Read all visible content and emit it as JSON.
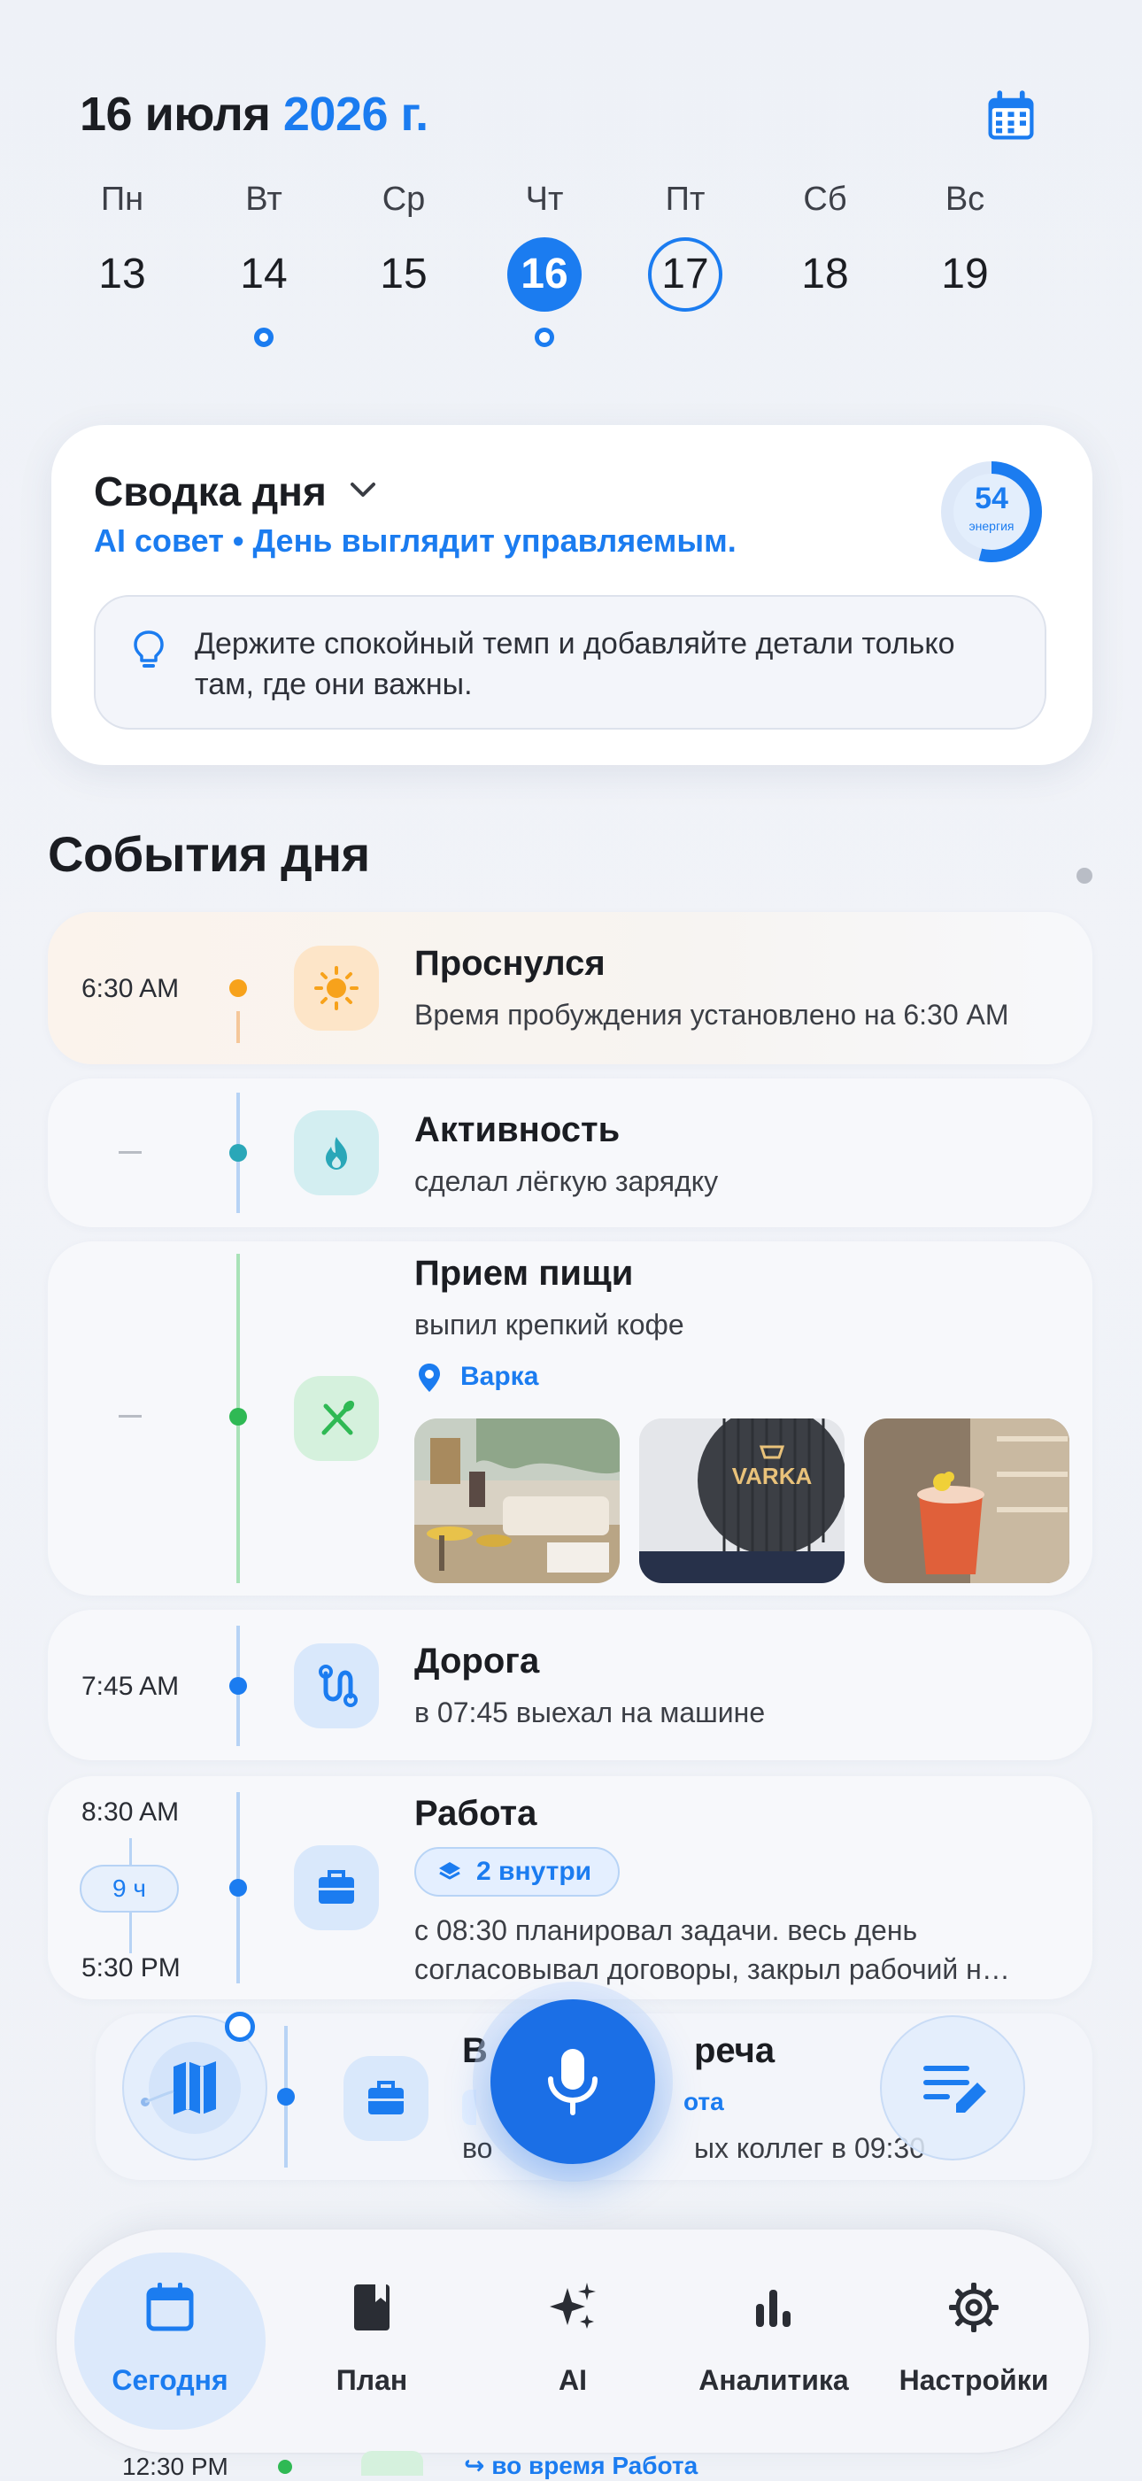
{
  "header": {
    "date_prefix": "16 июля",
    "year": "2026 г."
  },
  "week": [
    {
      "name": "Пн",
      "num": "13"
    },
    {
      "name": "Вт",
      "num": "14"
    },
    {
      "name": "Ср",
      "num": "15"
    },
    {
      "name": "Чт",
      "num": "16"
    },
    {
      "name": "Пт",
      "num": "17"
    },
    {
      "name": "Сб",
      "num": "18"
    },
    {
      "name": "Вс",
      "num": "19"
    }
  ],
  "summary": {
    "title": "Сводка дня",
    "ai_tip": "AI совет • День выглядит управляемым.",
    "energy_value": "54",
    "energy_label": "энергия",
    "energy_fraction": 0.54,
    "tip": "Держите спокойный темп и добавляйте детали только там, где они важны."
  },
  "events_title": "События дня",
  "events": {
    "wake": {
      "time": "6:30 AM",
      "title": "Проснулся",
      "desc": "Время пробуждения установлено на 6:30 AM"
    },
    "activity": {
      "title": "Активность",
      "desc": "сделал лёгкую зарядку"
    },
    "meal": {
      "title": "Прием пищи",
      "desc": "выпил крепкий кофе",
      "place": "Варка"
    },
    "road": {
      "time": "7:45 AM",
      "title": "Дорога",
      "desc": "в 07:45 выехал на машине"
    },
    "work": {
      "time_start": "8:30 AM",
      "duration": "9 ч",
      "time_end": "5:30 PM",
      "title": "Работа",
      "chip": "2 внутри",
      "desc_line1": "с 08:30 планировал задачи. весь день",
      "desc_line2": "согласовывал договоры, закрыл рабочий н…"
    },
    "meeting": {
      "title_left": "В",
      "title_right": "реча",
      "chip_left": "",
      "chip_right": "ота",
      "desc_left": "во",
      "desc_right": "ых коллег в 09:30"
    },
    "peek": {
      "time": "12:30 PM",
      "link": "во время Работа"
    }
  },
  "nav": [
    {
      "label": "Сегодня",
      "icon": "calendar-icon"
    },
    {
      "label": "План",
      "icon": "book-icon"
    },
    {
      "label": "AI",
      "icon": "sparkles-icon"
    },
    {
      "label": "Аналитика",
      "icon": "bar-chart-icon"
    },
    {
      "label": "Настройки",
      "icon": "gear-icon"
    }
  ],
  "colors": {
    "accent": "#1b7cf0",
    "wake": "#f7a21b",
    "activity": "#2aa7b8",
    "meal": "#2fb954"
  }
}
